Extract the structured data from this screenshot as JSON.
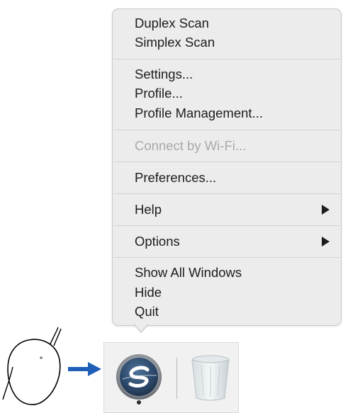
{
  "context_menu": {
    "sections": [
      {
        "items": [
          {
            "label": "Duplex Scan",
            "enabled": true
          },
          {
            "label": "Simplex Scan",
            "enabled": true
          }
        ]
      },
      {
        "items": [
          {
            "label": "Settings...",
            "enabled": true
          },
          {
            "label": "Profile...",
            "enabled": true
          },
          {
            "label": "Profile Management...",
            "enabled": true
          }
        ]
      },
      {
        "items": [
          {
            "label": "Connect by Wi-Fi...",
            "enabled": false
          }
        ]
      },
      {
        "items": [
          {
            "label": "Preferences...",
            "enabled": true
          }
        ]
      },
      {
        "items": [
          {
            "label": "Help",
            "enabled": true,
            "has_submenu": true
          }
        ]
      },
      {
        "items": [
          {
            "label": "Options",
            "enabled": true,
            "has_submenu": true
          }
        ]
      },
      {
        "items": [
          {
            "label": "Show All Windows",
            "enabled": true
          },
          {
            "label": "Hide",
            "enabled": true
          },
          {
            "label": "Quit",
            "enabled": true
          }
        ]
      }
    ]
  },
  "dock": {
    "apps": [
      {
        "name": "ScanSnap Manager",
        "icon": "scansnap-icon",
        "running": true
      },
      {
        "name": "Trash",
        "icon": "trash-icon",
        "running": false
      }
    ]
  },
  "illustration": {
    "pointer": "mouse-icon",
    "indicator": "right-arrow-icon",
    "colors": {
      "arrow": "#1f5fb8",
      "menu_background": "#ececec",
      "disabled_text": "#a9a9a9"
    }
  }
}
